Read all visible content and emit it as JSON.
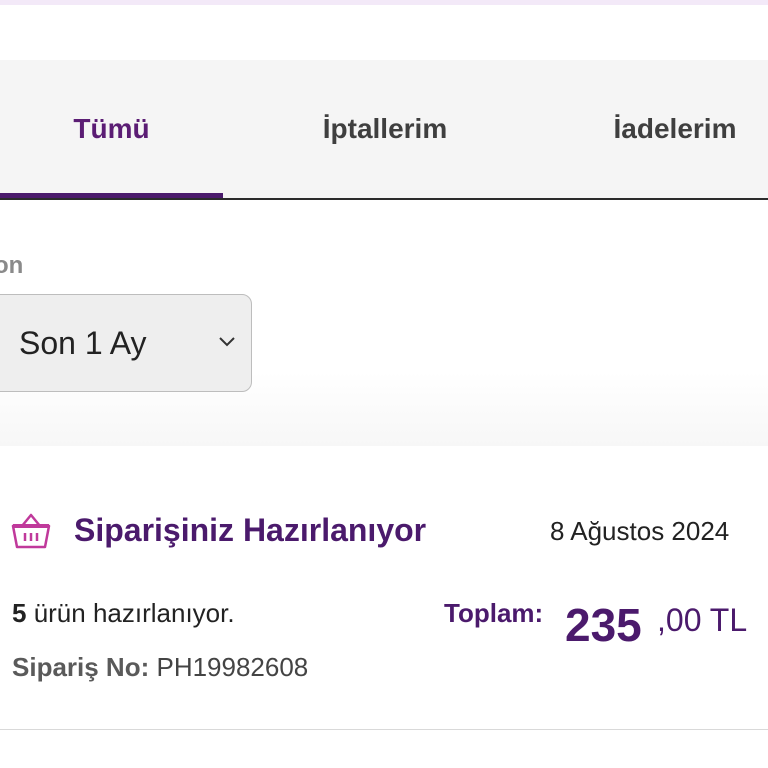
{
  "tabs": [
    {
      "label": "Tümü",
      "active": true
    },
    {
      "label": "İptallerim",
      "active": false
    },
    {
      "label": "İadelerim",
      "active": false
    }
  ],
  "filter": {
    "label": "on",
    "selected": "Son 1 Ay"
  },
  "order": {
    "status": "Siparişiniz Hazırlanıyor",
    "date": "8 Ağustos 2024",
    "item_count": "5",
    "item_text": " ürün hazırlanıyor.",
    "order_no_label": "Sipariş No:",
    "order_no": " PH19982608",
    "total_label": "Toplam:",
    "total_integer": "235",
    "total_decimal": ",00 TL"
  },
  "colors": {
    "accent": "#4b1a6c",
    "basket_icon": "#c0399b"
  }
}
